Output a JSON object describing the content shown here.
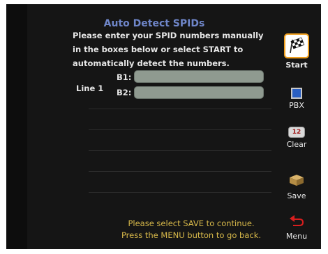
{
  "title": "Auto Detect SPIDs",
  "instructions": [
    "Please enter your SPID numbers manually",
    "in the boxes below or select START to",
    "automatically detect the numbers."
  ],
  "line": {
    "label": "Line 1",
    "fields": [
      {
        "label": "B1:",
        "value": ""
      },
      {
        "label": "B2:",
        "value": ""
      }
    ]
  },
  "footer": [
    "Please select SAVE to continue.",
    "Press the MENU button to go back."
  ],
  "menu": {
    "items": [
      {
        "label": "Start",
        "icon": "checkered-flag-icon",
        "selected": true
      },
      {
        "label": "PBX",
        "icon": "pbx-square-icon"
      },
      {
        "label": "Clear",
        "icon": "clear-icon",
        "icon_text": "12"
      },
      {
        "label": "Save",
        "icon": "save-box-icon"
      },
      {
        "label": "Menu",
        "icon": "back-arrow-icon"
      }
    ]
  },
  "colors": {
    "background": "#151515",
    "title": "#6f86c9",
    "footer_text": "#d8b94a",
    "field": "#8f9a90",
    "selection": "#f0a020"
  }
}
